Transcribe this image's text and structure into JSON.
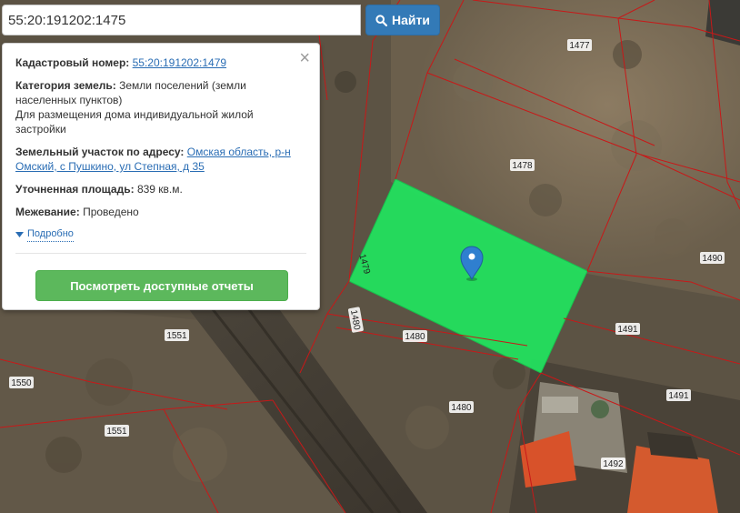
{
  "search": {
    "value": "55:20:191202:1475",
    "button_label": "Найти"
  },
  "popup": {
    "cadastral_label": "Кадастровый номер:",
    "cadastral_value": "55:20:191202:1479",
    "category_label": "Категория земель:",
    "category_value": "Земли поселений (земли населенных пунктов)",
    "purpose": "Для размещения дома индивидуальной жилой застройки",
    "address_label": "Земельный участок по адресу:",
    "address_value": "Омская область, р-н Омский, с Пушкино, ул Степная, д 35",
    "area_label": "Уточненная площадь:",
    "area_value": "839 кв.м.",
    "survey_label": "Межевание:",
    "survey_value": "Проведено",
    "details_label": "Подробно",
    "report_button": "Посмотреть доступные отчеты"
  },
  "map": {
    "parcel_labels": [
      "1477",
      "1478",
      "1490",
      "1491",
      "1491",
      "1480",
      "1480",
      "1480",
      "1479",
      "1551",
      "1550",
      "1551",
      "1492"
    ],
    "selected_parcel_color": "#22e05e",
    "boundary_color": "#c81818",
    "marker_color": "#2f7fcf"
  }
}
